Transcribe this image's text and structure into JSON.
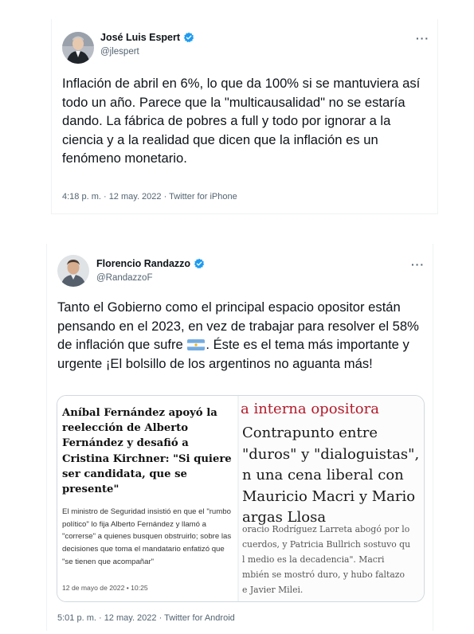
{
  "tweets": [
    {
      "name": "José Luis Espert",
      "handle": "@jlespert",
      "more": "···",
      "text": "Inflación de abril en 6%, lo que da 100% si se mantuviera así todo un año. Parece que la \"multicausalidad\" no se estaría dando. La fábrica de pobres a full y todo por ignorar a la ciencia y a la realidad que dicen que la inflación es un fenómeno monetario.",
      "meta": "4:18 p. m. · 12 may. 2022 · Twitter for iPhone"
    },
    {
      "name": "Florencio Randazzo",
      "handle": "@RandazzoF",
      "more": "···",
      "text_before_flag": "Tanto el Gobierno como el principal espacio opositor están pensando en el 2023, en vez de trabajar para resolver el 58% de inflación que sufre ",
      "flag_icon": "argentina-flag-emoji",
      "text_after_flag": ". Éste es el tema más importante y urgente ¡El bolsillo de los argentinos no aguanta más!",
      "meta": "5:01 p. m. · 12 may. 2022 · Twitter for Android",
      "card": {
        "left": {
          "headline": "Aníbal Fernández apoyó la reelección de Alberto Fernández y desafió a Cristina Kirchner: \"Si quiere ser candidata, que se presente\"",
          "summary": "El ministro de Seguridad insistió en que el \"rumbo político\" lo fija Alberto Fernández y llamó a \"correrse\" a quienes busquen obstruirlo; sobre las decisiones que toma el mandatario enfatizó que \"se tienen que acompañar\"",
          "date": "12 de mayo de 2022 • 10:25"
        },
        "right": {
          "section": "a interna opositora",
          "headline_lines": [
            "Contrapunto entre",
            "\"duros\" y \"dialoguistas\",",
            "n una cena liberal con",
            "Mauricio Macri y Mario",
            "argas Llosa"
          ],
          "summary_lines": [
            "oracio Rodríguez Larreta abogó por lo",
            "cuerdos, y Patricia Bullrich sostuvo qu",
            "l medio es la decadencia\". Macri",
            "mbién se mostró duro, y hubo faltazo",
            "e Javier Milei."
          ]
        }
      }
    }
  ],
  "colors": {
    "text": "#0f1419",
    "secondary": "#536471",
    "verified": "#1d9bf0",
    "card_border": "#cfd9de",
    "section_red": "#b31a2a"
  }
}
